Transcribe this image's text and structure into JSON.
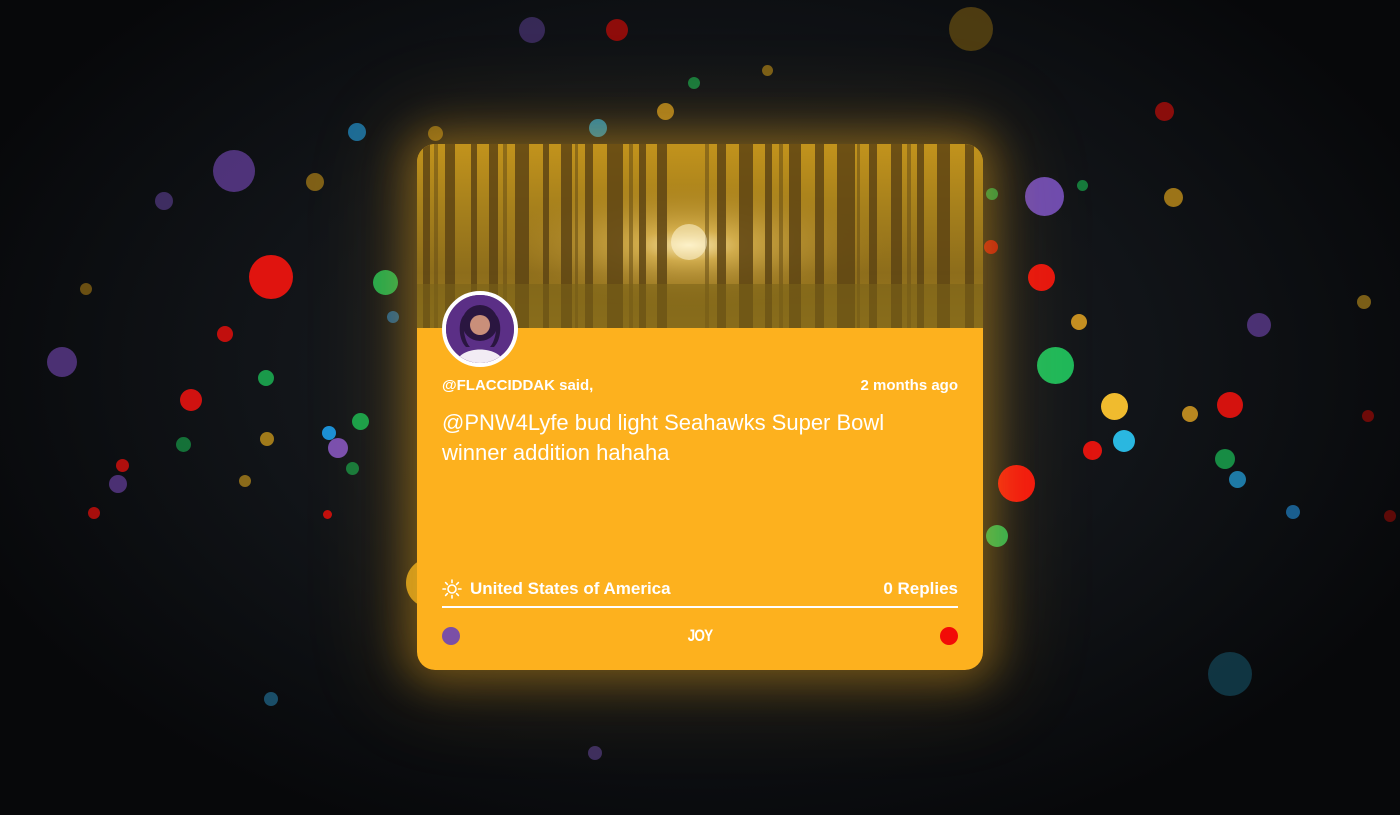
{
  "post": {
    "username": "@FLACCIDDAK",
    "said_label": "said,",
    "timestamp": "2 months ago",
    "message": "@PNW4Lyfe bud light Seahawks Super Bowl winner addition hahaha",
    "location": "United States of America",
    "location_icon": "sun-icon",
    "replies": "0 Replies",
    "mood": "JOY"
  },
  "colors": {
    "card": "#fdb11e",
    "text": "#ffffff",
    "mood_dot_left": "#7b4fa6",
    "mood_dot_right": "#f20b07",
    "background": "#07080a"
  }
}
